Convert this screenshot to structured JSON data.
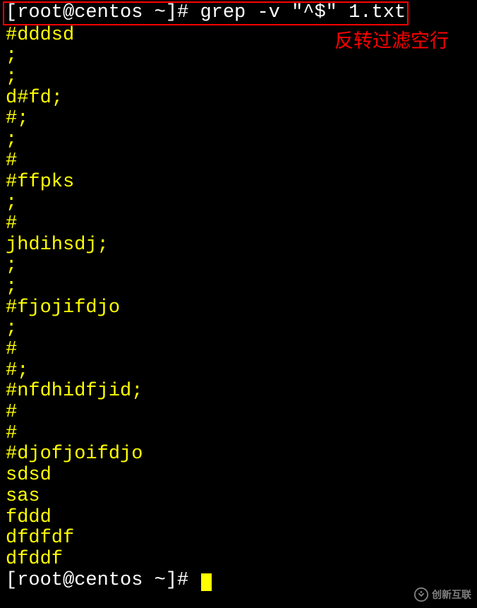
{
  "command_line": {
    "prefix": "[root@centos ~]# ",
    "command": "grep -v \"^$\" 1.txt"
  },
  "output": [
    "#dddsd",
    ";",
    ";",
    "d#fd;",
    "#;",
    ";",
    "#",
    "#ffpks",
    ";",
    "#",
    "jhdihsdj;",
    ";",
    ";",
    "#fjojifdjo",
    ";",
    "#",
    "#;",
    "#nfdhidfjid;",
    "#",
    "#",
    "#djofjoifdjo",
    "sdsd",
    "sas",
    "fddd",
    "dfdfdf",
    "dfddf"
  ],
  "bottom_prompt": "[root@centos ~]# ",
  "annotation": "反转过滤空行",
  "watermark": "创新互联"
}
